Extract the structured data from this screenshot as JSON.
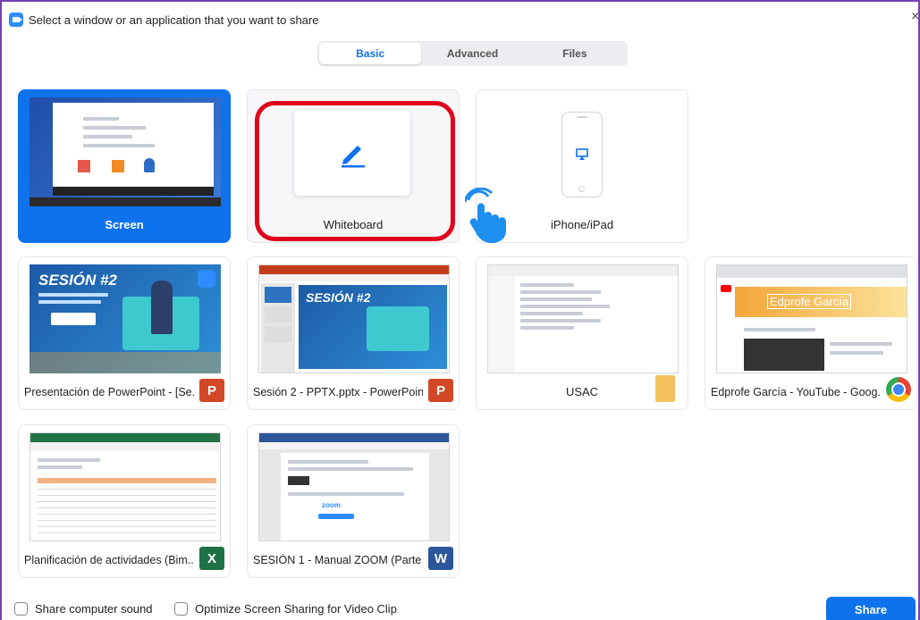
{
  "window": {
    "title": "Select a window or an application that you want to share",
    "close_glyph": "×"
  },
  "tabs": [
    {
      "label": "Basic",
      "active": true
    },
    {
      "label": "Advanced",
      "active": false
    },
    {
      "label": "Files",
      "active": false
    }
  ],
  "tiles": {
    "screen": {
      "label": "Screen",
      "selected": true
    },
    "whiteboard": {
      "label": "Whiteboard",
      "icon": "pencil-icon"
    },
    "iphone": {
      "label": "iPhone/iPad",
      "icon": "airplay-icon"
    },
    "ppt_presentation": {
      "label": "Presentación de PowerPoint - [Se...",
      "app": "powerpoint",
      "thumb_title": "SESIÓN #2"
    },
    "ppt_sesion2": {
      "label": "Sesión 2 - PPTX.pptx - PowerPoint",
      "app": "powerpoint",
      "thumb_title": "SESIÓN #2"
    },
    "usac": {
      "label": "USAC",
      "app": "file-explorer"
    },
    "youtube": {
      "label": "Edprofe García - YouTube - Goog...",
      "app": "chrome",
      "thumb_banner": "Edprofe García"
    },
    "excel": {
      "label": "Planificación de actividades (Bim...",
      "app": "excel"
    },
    "word": {
      "label": "SESIÓN 1 - Manual ZOOM (Parte ...",
      "app": "word",
      "thumb_logo": "zoom"
    }
  },
  "badges": {
    "ppt": "P",
    "excel": "X",
    "word": "W"
  },
  "footer": {
    "share_sound": "Share computer sound",
    "optimize": "Optimize Screen Sharing for Video Clip",
    "share_button": "Share"
  },
  "colors": {
    "accent": "#0e72ed",
    "highlight": "#e0001b",
    "frame": "#7b3fb3"
  }
}
